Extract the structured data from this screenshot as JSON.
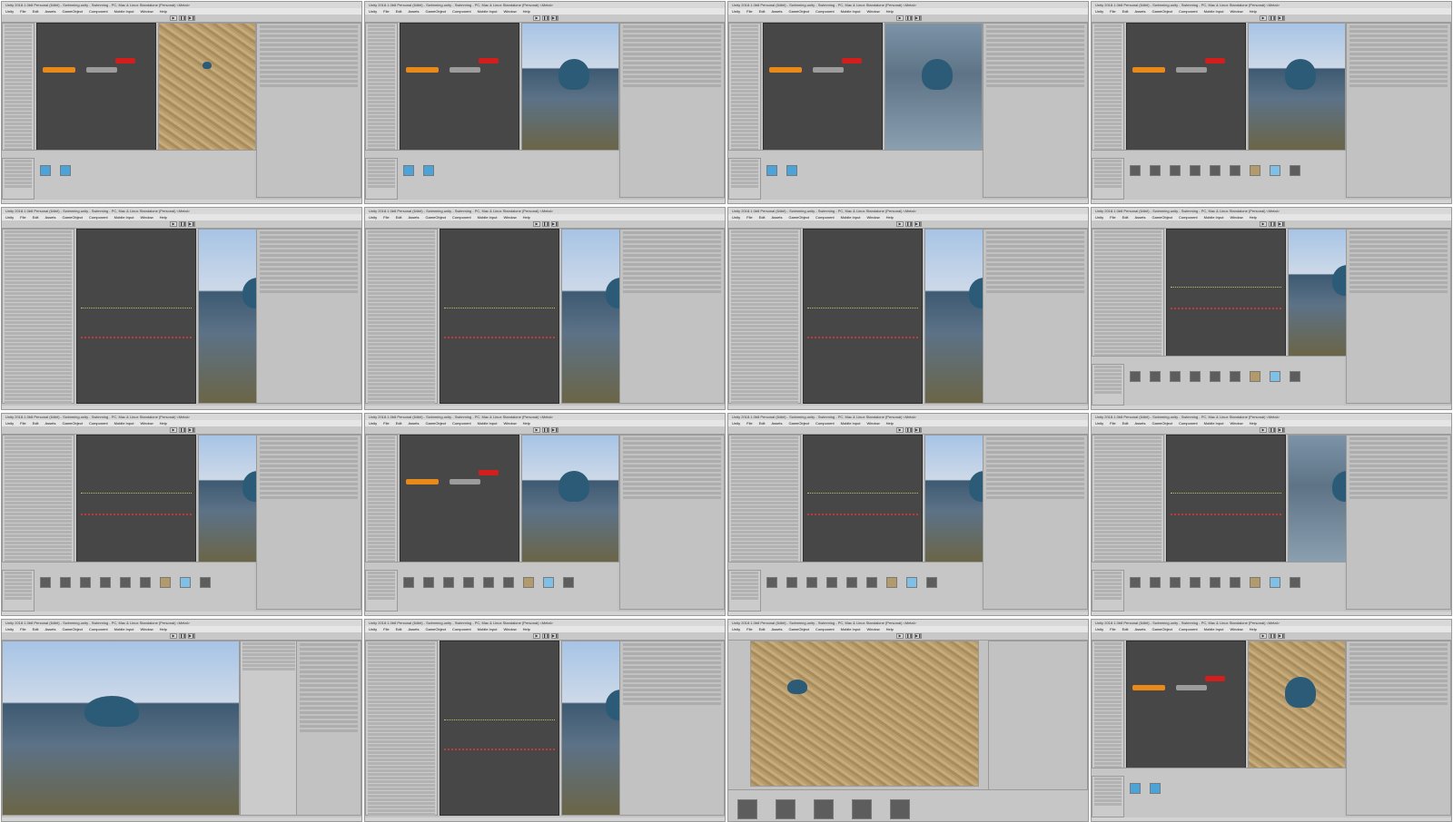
{
  "app_title": "Unity 2018.1.0b8 Personal (64bit) - Swimming.unity - Swimming - PC, Mac & Linux Standalone (Personal) <Metal>",
  "menu": [
    "Unity",
    "File",
    "Edit",
    "Assets",
    "GameObject",
    "Component",
    "Mobile Input",
    "Window",
    "Help"
  ],
  "toolbar": {
    "play": "▶",
    "pause": "❚❚",
    "step": "▶❚"
  },
  "tiles": [
    {
      "scene": "sand",
      "layout": "animator"
    },
    {
      "scene": "sky",
      "layout": "animator"
    },
    {
      "scene": "water",
      "layout": "animator"
    },
    {
      "scene": "sky",
      "layout": "animator-proj"
    },
    {
      "scene": "sky",
      "layout": "curves"
    },
    {
      "scene": "sky",
      "layout": "curves"
    },
    {
      "scene": "sky",
      "layout": "curves"
    },
    {
      "scene": "sky",
      "layout": "curves-proj"
    },
    {
      "scene": "sky",
      "layout": "curves-proj"
    },
    {
      "scene": "sky",
      "layout": "animator-proj"
    },
    {
      "scene": "sky",
      "layout": "curves-proj"
    },
    {
      "scene": "water",
      "layout": "curves-proj"
    },
    {
      "scene": "sky",
      "layout": "scene-wide"
    },
    {
      "scene": "sky",
      "layout": "curves"
    },
    {
      "scene": "sand",
      "layout": "zoom"
    },
    {
      "scene": "sand",
      "layout": "animator-sand"
    }
  ],
  "colors": {
    "orange_node": "#e88a1a",
    "red_node": "#d41e1e",
    "grey_node": "#9c9c9c",
    "avatar": "#2c5b78"
  }
}
